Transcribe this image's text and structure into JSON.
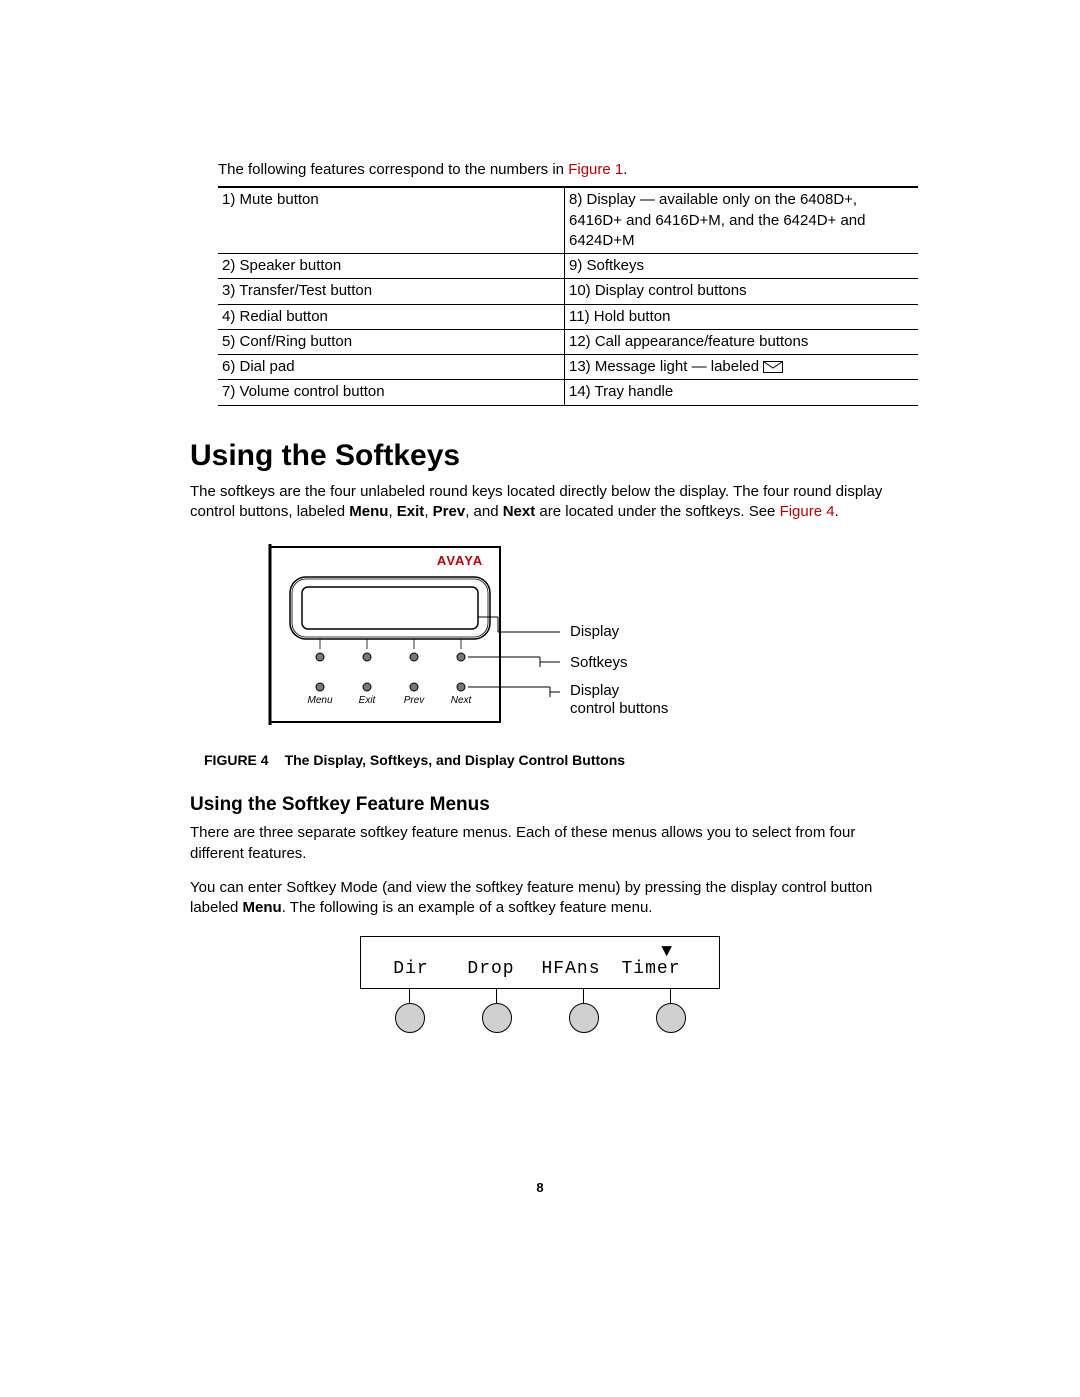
{
  "intro_prefix": "The following features correspond to the numbers in ",
  "intro_link": "Figure 1",
  "intro_suffix": ".",
  "table_rows": [
    {
      "left": "1) Mute button",
      "right": "8) Display — available only on the 6408D+, 6416D+ and 6416D+M, and the 6424D+ and 6424D+M"
    },
    {
      "left": "2) Speaker button",
      "right": "9) Softkeys"
    },
    {
      "left": "3) Transfer/Test button",
      "right": "10) Display control buttons"
    },
    {
      "left": "4) Redial button",
      "right": "11) Hold button"
    },
    {
      "left": "5) Conf/Ring button",
      "right": "12) Call appearance/feature buttons"
    },
    {
      "left": "6) Dial pad",
      "right": "13) Message light — labeled ",
      "right_has_icon": true
    },
    {
      "left": "7) Volume control button",
      "right": "14) Tray handle"
    }
  ],
  "h1": "Using the Softkeys",
  "para1_parts": {
    "a": "The softkeys are the four unlabeled round keys located directly below the display. The four round display control buttons, labeled ",
    "b1": "Menu",
    "c": ", ",
    "b2": "Exit",
    "d": ", ",
    "b3": "Prev",
    "e": ", and ",
    "b4": "Next",
    "f": " are located under the softkeys. See ",
    "link": "Figure 4",
    "g": "."
  },
  "figure4": {
    "brand": "AVAYA",
    "control_labels": [
      "Menu",
      "Exit",
      "Prev",
      "Next"
    ],
    "callouts": {
      "display": "Display",
      "softkeys": "Softkeys",
      "ctrl1": "Display",
      "ctrl2": "control buttons"
    },
    "caption_label": "FIGURE 4",
    "caption_text": "The Display, Softkeys, and Display Control Buttons"
  },
  "h2": "Using the Softkey Feature Menus",
  "para2": "There are three separate softkey feature menus. Each of these menus allows you to select from four different features.",
  "para3_parts": {
    "a": "You can enter Softkey Mode (and view the softkey feature menu) by pressing the display control button labeled ",
    "b": "Menu",
    "c": ". The following is an example of a softkey feature menu."
  },
  "menu_example": {
    "arrow": "▼",
    "labels": [
      "Dir",
      "Drop",
      "HFAns",
      "Timer"
    ]
  },
  "page_number": "8"
}
